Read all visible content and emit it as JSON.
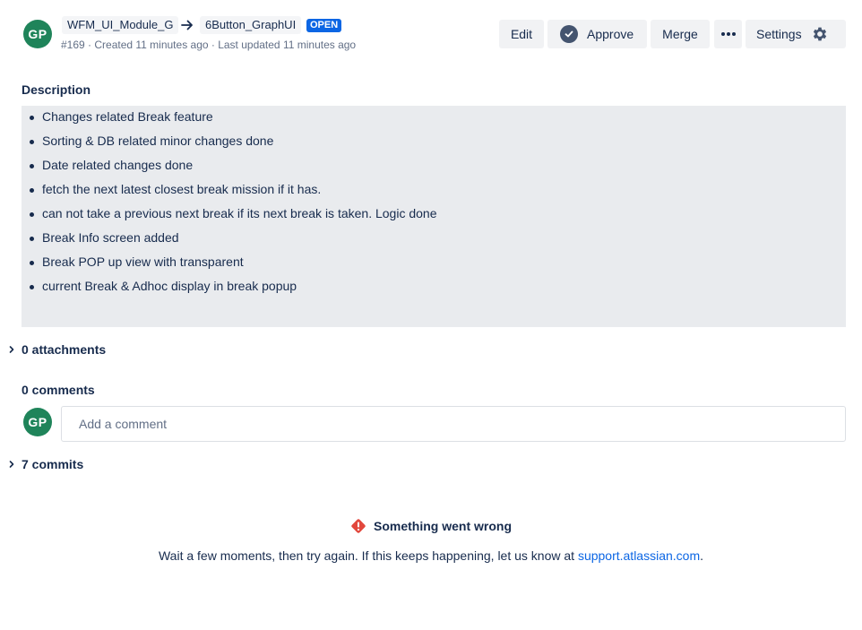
{
  "pr": {
    "avatar_initials": "GP",
    "source_branch": "WFM_UI_Module_G",
    "target_branch": "6Button_GraphUI",
    "status": "OPEN",
    "meta": "#169 · Created 11 minutes ago · Last updated 11 minutes ago"
  },
  "toolbar": {
    "edit_label": "Edit",
    "approve_label": "Approve",
    "merge_label": "Merge",
    "more_icon": "more-horizontal-icon",
    "settings_label": "Settings",
    "settings_icon": "gear-icon"
  },
  "description": {
    "heading": "Description",
    "items": [
      "Changes related Break feature",
      "Sorting & DB related minor changes done",
      "Date related changes done",
      "fetch the next latest closest break mission if it has.",
      "can not take a previous next break if its next break is taken. Logic done",
      "Break Info screen added",
      "Break POP up view with transparent",
      "current Break & Adhoc display in break popup"
    ]
  },
  "attachments": {
    "label": "0 attachments"
  },
  "comments": {
    "heading": "0 comments",
    "avatar_initials": "GP",
    "placeholder": "Add a comment"
  },
  "commits": {
    "label": "7 commits"
  },
  "error": {
    "title": "Something went wrong",
    "message_prefix": "Wait a few moments, then try again. If this keeps happening, let us know at ",
    "link_text": "support.atlassian.com",
    "message_suffix": "."
  },
  "colors": {
    "avatar": "#1f845a",
    "lozenge": "#0c66e4",
    "button_bg": "#f1f2f4",
    "description_bg": "#e9ebee",
    "link": "#0c66e4",
    "error_icon": "#e2483d"
  }
}
